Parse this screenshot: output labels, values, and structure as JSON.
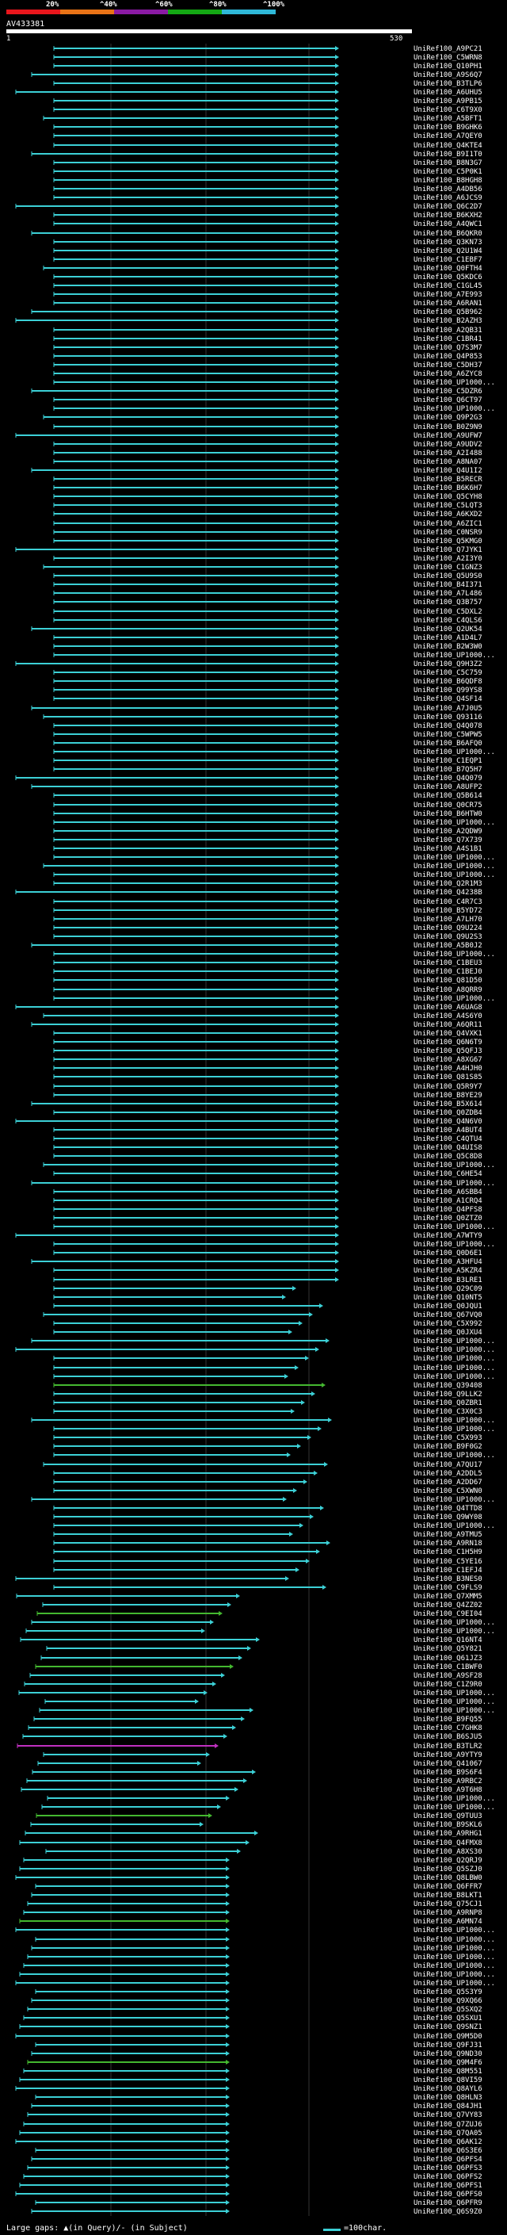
{
  "header": {
    "percent_labels": [
      "20%",
      "^40%",
      "^60%",
      "^80%",
      "^100%"
    ],
    "color_scale": [
      "#e8161c",
      "#e87317",
      "#8a1aa3",
      "#14a814",
      "#2fb8d8"
    ]
  },
  "query": {
    "name": "AV433381",
    "start": "1",
    "end": "530"
  },
  "footer": {
    "legend_text": "Large gaps: ▲(in Query)/- (in Subject)",
    "scale_text": "=100char."
  },
  "hits": [
    "UniRef100_A9PC21",
    "UniRef100_C5WRN8",
    "UniRef100_Q10PH1",
    "UniRef100_A9S6Q7",
    "UniRef100_B3TLP6",
    "UniRef100_A6UHU5",
    "UniRef100_A9PB15",
    "UniRef100_C6T9X0",
    "UniRef100_A5BFT1",
    "UniRef100_B9GHK6",
    "UniRef100_A7QEY0",
    "UniRef100_Q4KTE4",
    "UniRef100_B9I1T0",
    "UniRef100_B8N3G7",
    "UniRef100_C5P0K1",
    "UniRef100_B8HGH8",
    "UniRef100_A4DB56",
    "UniRef100_A6JCS9",
    "UniRef100_Q6C2D7",
    "UniRef100_B6KXH2",
    "UniRef100_A4QWC1",
    "UniRef100_B6QKR0",
    "UniRef100_Q3KN73",
    "UniRef100_Q2U1W4",
    "UniRef100_C1EBF7",
    "UniRef100_Q0FTH4",
    "UniRef100_Q5KDC6",
    "UniRef100_C1GL45",
    "UniRef100_A7E993",
    "UniRef100_A6RAN1",
    "UniRef100_Q5B962",
    "UniRef100_B2AZH3",
    "UniRef100_A2QB31",
    "UniRef100_C1BR41",
    "UniRef100_Q7S3M7",
    "UniRef100_Q4P853",
    "UniRef100_C5DH37",
    "UniRef100_A6ZYC8",
    "UniRef100_UP1000...",
    "UniRef100_C5DZR6",
    "UniRef100_Q6CT97",
    "UniRef100_UP1000...",
    "UniRef100_Q9P2G3",
    "UniRef100_B0Z9N9",
    "UniRef100_A9UFW7",
    "UniRef100_A9UDV2",
    "UniRef100_A2I488",
    "UniRef100_A8NA07",
    "UniRef100_Q4U1I2",
    "UniRef100_B5RECR",
    "UniRef100_B6K6H7",
    "UniRef100_Q5CYH8",
    "UniRef100_C5LQT3",
    "UniRef100_A6KXD2",
    "UniRef100_A6ZIC1",
    "UniRef100_C0NSR9",
    "UniRef100_Q5KMG0",
    "UniRef100_Q7JYK1",
    "UniRef100_A2I3Y0",
    "UniRef100_C1GNZ3",
    "UniRef100_Q5U9S0",
    "UniRef100_B4I371",
    "UniRef100_A7L486",
    "UniRef100_Q3B757",
    "UniRef100_C5DXL2",
    "UniRef100_C4QLS6",
    "UniRef100_Q2UK54",
    "UniRef100_A1D4L7",
    "UniRef100_B2W3W0",
    "UniRef100_UP1000...",
    "UniRef100_Q9H3Z2",
    "UniRef100_C5C759",
    "UniRef100_B6QDF8",
    "UniRef100_Q99YS8",
    "UniRef100_Q4SF14",
    "UniRef100_A7J0U5",
    "UniRef100_Q93116",
    "UniRef100_Q4Q078",
    "UniRef100_C5WPW5",
    "UniRef100_B6AFQ0",
    "UniRef100_UP1000...",
    "UniRef100_C1EQP1",
    "UniRef100_B7Q5H7",
    "UniRef100_Q4Q079",
    "UniRef100_A8UFP2",
    "UniRef100_Q5B614",
    "UniRef100_Q0CR75",
    "UniRef100_B6HTW0",
    "UniRef100_UP1000...",
    "UniRef100_A2QDW9",
    "UniRef100_Q7X739",
    "UniRef100_A4S1B1",
    "UniRef100_UP1000...",
    "UniRef100_UP1000...",
    "UniRef100_UP1000...",
    "UniRef100_Q2R1M3",
    "UniRef100_Q4238B",
    "UniRef100_C4R7C3",
    "UniRef100_B5YD72",
    "UniRef100_A7LH70",
    "UniRef100_Q9U224",
    "UniRef100_Q9U2S3",
    "UniRef100_A5B0J2",
    "UniRef100_UP1000...",
    "UniRef100_C1BEU3",
    "UniRef100_C1BEJ0",
    "UniRef100_Q81D50",
    "UniRef100_A8QRR9",
    "UniRef100_UP1000...",
    "UniRef100_A6UAG8",
    "UniRef100_A4S6Y0",
    "UniRef100_A6QR11",
    "UniRef100_Q4VXK1",
    "UniRef100_Q6N6T9",
    "UniRef100_Q5QFJ3",
    "UniRef100_A8XG67",
    "UniRef100_A4HJH0",
    "UniRef100_Q81S85",
    "UniRef100_Q5R9Y7",
    "UniRef100_B8YE29",
    "UniRef100_B5X614",
    "UniRef100_Q0ZDB4",
    "UniRef100_Q4N6V0",
    "UniRef100_A4BUT4",
    "UniRef100_C4QTU4",
    "UniRef100_Q4UIS8",
    "UniRef100_Q5C8D8",
    "UniRef100_UP1000...",
    "UniRef100_C6HE54",
    "UniRef100_UP1000...",
    "UniRef100_A6SBB4",
    "UniRef100_A1CRQ4",
    "UniRef100_Q4PFS8",
    "UniRef100_Q0ZTZ0",
    "UniRef100_UP1000...",
    "UniRef100_A7WTY9",
    "UniRef100_UP1000...",
    "UniRef100_Q0D6E1",
    "UniRef100_A3HFU4",
    "UniRef100_A5KZR4",
    "UniRef100_B3LRE1",
    "UniRef100_Q29C09",
    "UniRef100_Q10NT5",
    "UniRef100_Q0JQU1",
    "UniRef100_Q67VQ0",
    "UniRef100_C5X992",
    "UniRef100_Q0JXU4",
    "UniRef100_UP1000...",
    "UniRef100_UP1000...",
    "UniRef100_UP1000...",
    "UniRef100_UP1000...",
    "UniRef100_UP1000...",
    "UniRef100_Q39408",
    "UniRef100_Q9LLK2",
    "UniRef100_Q0ZBR1",
    "UniRef100_C3X0C3",
    "UniRef100_UP1000...",
    "UniRef100_UP1000...",
    "UniRef100_C5X993",
    "UniRef100_B9F0G2",
    "UniRef100_UP1000...",
    "UniRef100_A7QU17",
    "UniRef100_A2DDL5",
    "UniRef100_A2DD67",
    "UniRef100_C5XWN0",
    "UniRef100_UP1000...",
    "UniRef100_Q4TTD8",
    "UniRef100_Q9WY08",
    "UniRef100_UP1000...",
    "UniRef100_A9TMU5",
    "UniRef100_A9RN18",
    "UniRef100_C1H5H9",
    "UniRef100_C5YE16",
    "UniRef100_C1EFJ4",
    "UniRef100_B3NES0",
    "UniRef100_C9FLS9",
    "UniRef100_Q7XMM5",
    "UniRef100_Q4ZZ02",
    "UniRef100_C9EI04",
    "UniRef100_UP1000...",
    "UniRef100_UP1000...",
    "UniRef100_Q16NT4",
    "UniRef100_Q5Y821",
    "UniRef100_Q61JZ3",
    "UniRef100_C1BWF0",
    "UniRef100_A9SF28",
    "UniRef100_C1Z9R0",
    "UniRef100_UP1000...",
    "UniRef100_UP1000...",
    "UniRef100_UP1000...",
    "UniRef100_B9FQ55",
    "UniRef100_C7GHK8",
    "UniRef100_B6SJU5",
    "UniRef100_B3TLR2",
    "UniRef100_A9YTY9",
    "UniRef100_Q41067",
    "UniRef100_B9S6F4",
    "UniRef100_A9RBC2",
    "UniRef100_A9T6H8",
    "UniRef100_UP1000...",
    "UniRef100_UP1000...",
    "UniRef100_Q9TUU3",
    "UniRef100_B9SKL6",
    "UniRef100_A9RHG1",
    "UniRef100_Q4FMX8",
    "UniRef100_A8XS30",
    "UniRef100_Q2QRJ9",
    "UniRef100_Q5SZJ0",
    "UniRef100_Q8LBW0",
    "UniRef100_Q6FFR7",
    "UniRef100_B8LKT1",
    "UniRef100_Q75CJ1",
    "UniRef100_A9RNP8",
    "UniRef100_A6MN74",
    "UniRef100_UP1000...",
    "UniRef100_UP1000...",
    "UniRef100_UP1000...",
    "UniRef100_UP1000...",
    "UniRef100_UP1000...",
    "UniRef100_UP1000...",
    "UniRef100_UP1000...",
    "UniRef100_Q5S3Y9",
    "UniRef100_Q9XQ66",
    "UniRef100_Q5SXQ2",
    "UniRef100_Q5SXU1",
    "UniRef100_Q9SNZ1",
    "UniRef100_Q9M5D0",
    "UniRef100_Q9FJ31",
    "UniRef100_Q9ND30",
    "UniRef100_Q9M4F6",
    "UniRef100_Q8M551",
    "UniRef100_Q8VI59",
    "UniRef100_Q8AYL6",
    "UniRef100_Q8HLN3",
    "UniRef100_Q84JH1",
    "UniRef100_Q7VY83",
    "UniRef100_Q7ZUJ6",
    "UniRef100_Q7QA05",
    "UniRef100_Q6AK12",
    "UniRef100_Q6S3E6",
    "UniRef100_Q6PFS4",
    "UniRef100_Q6PFS3",
    "UniRef100_Q6PFS2",
    "UniRef100_Q6PFS1",
    "UniRef100_Q6PFS0",
    "UniRef100_Q6PFR9",
    "UniRef100_Q6S9Z0"
  ]
}
